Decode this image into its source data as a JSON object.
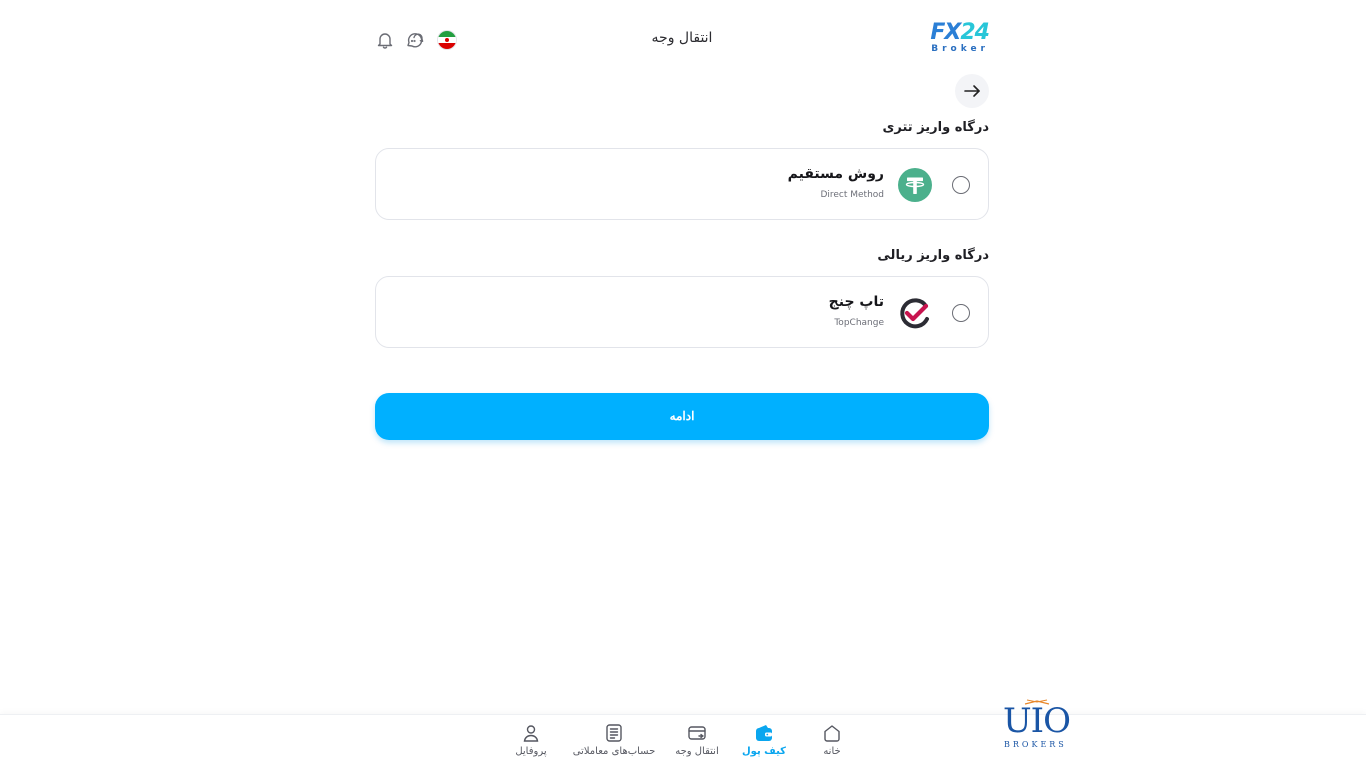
{
  "header": {
    "title": "انتقال وجه",
    "logo_main_left": "FX",
    "logo_main_right": "24",
    "logo_sub": "Broker",
    "icons": [
      "bell-icon",
      "chat-icon",
      "iran-flag-icon"
    ]
  },
  "sections": [
    {
      "title": "درگاه واریز تتری",
      "options": [
        {
          "name": "روش مستقیم",
          "subtitle": "Direct Method",
          "icon": "tether-icon",
          "selected": false
        }
      ]
    },
    {
      "title": "درگاه واریز ریالی",
      "options": [
        {
          "name": "تاپ چنج",
          "subtitle": "TopChange",
          "icon": "topchange-icon",
          "selected": false
        }
      ]
    }
  ],
  "continue_label": "ادامه",
  "bottom_nav": [
    {
      "label": "پروفایل",
      "icon": "user-icon",
      "active": false
    },
    {
      "label": "حساب‌های معاملاتی",
      "icon": "list-icon",
      "active": false
    },
    {
      "label": "انتقال وجه",
      "icon": "card-transfer-icon",
      "active": false
    },
    {
      "label": "کیف پول",
      "icon": "wallet-icon",
      "active": true
    },
    {
      "label": "خانه",
      "icon": "home-icon",
      "active": false
    }
  ],
  "watermark": {
    "main": "UIO",
    "sub": "BROKERS"
  },
  "colors": {
    "accent": "#00b0ff",
    "tether": "#4bb08c",
    "topchange_check": "#c8144f",
    "active_nav": "#0aa6ef"
  }
}
